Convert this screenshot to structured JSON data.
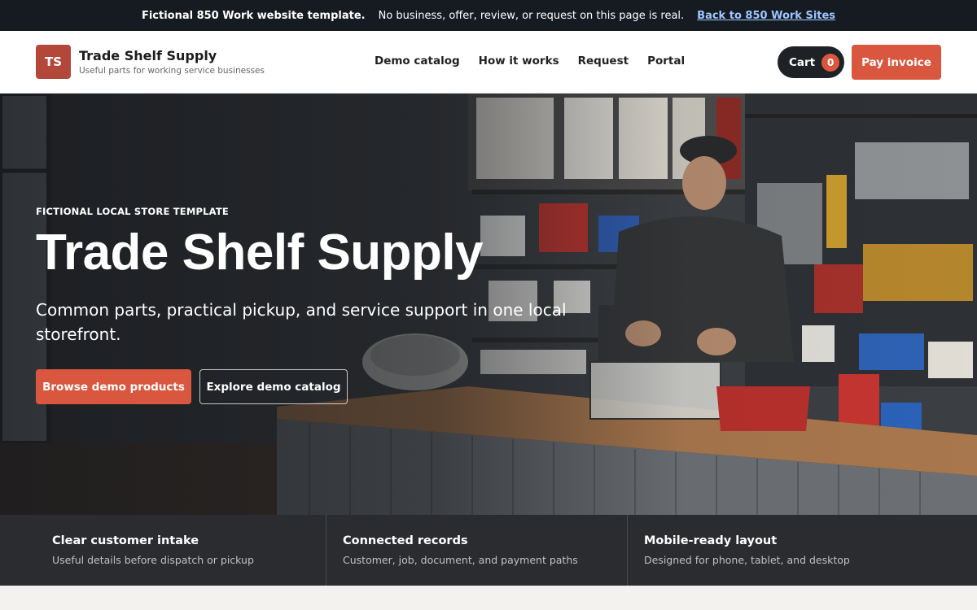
{
  "notice": {
    "strong": "Fictional 850 Work website template.",
    "text": "No business, offer, review, or request on this page is real.",
    "link": "Back to 850 Work Sites"
  },
  "header": {
    "logo_initials": "TS",
    "brand_name": "Trade Shelf Supply",
    "tagline": "Useful parts for working service businesses",
    "nav": [
      "Demo catalog",
      "How it works",
      "Request",
      "Portal"
    ],
    "cart_label": "Cart",
    "cart_count": "0",
    "pay_label": "Pay invoice"
  },
  "hero": {
    "eyebrow": "FICTIONAL LOCAL STORE TEMPLATE",
    "title": "Trade Shelf Supply",
    "subtitle": "Common parts, practical pickup, and service support in one local storefront.",
    "primary_button": "Browse demo products",
    "secondary_button": "Explore demo catalog"
  },
  "features": [
    {
      "title": "Clear customer intake",
      "desc": "Useful details before dispatch or pickup"
    },
    {
      "title": "Connected records",
      "desc": "Customer, job, document, and payment paths"
    },
    {
      "title": "Mobile-ready layout",
      "desc": "Designed for phone, tablet, and desktop"
    }
  ],
  "colors": {
    "accent": "#d9573f",
    "logo_bg": "#b3473a",
    "dark": "#161b22",
    "strip": "#2a2c30"
  },
  "icons": [
    "cart-icon"
  ]
}
